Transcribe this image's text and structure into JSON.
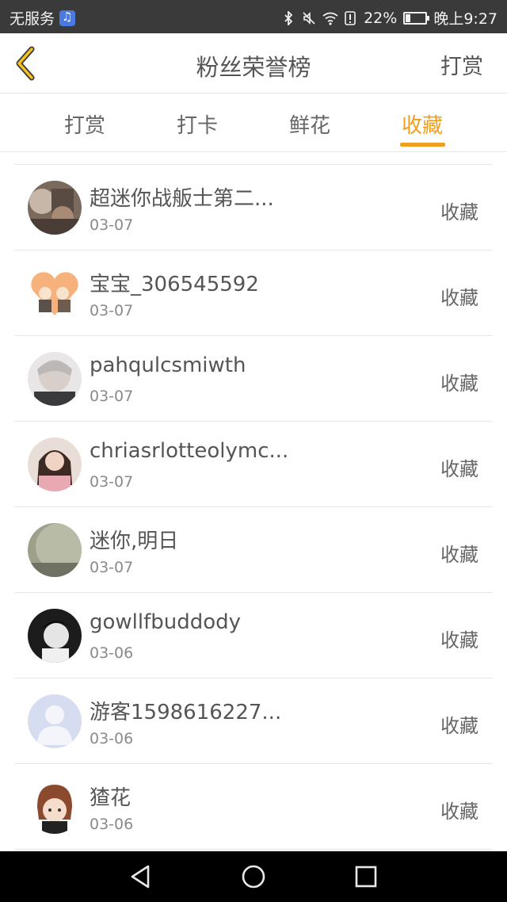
{
  "status_bar": {
    "carrier": "无服务",
    "battery_level": "22%",
    "battery_fraction": 0.22,
    "time": "晚上9:27",
    "icons": [
      "music-app-icon",
      "bluetooth-icon",
      "mute-icon",
      "wifi-icon",
      "alert-icon",
      "battery-icon"
    ]
  },
  "app_bar": {
    "title": "粉丝荣誉榜",
    "right_action": "打赏",
    "back_icon": "chevron-left-icon",
    "accent_color": "#f0a01e"
  },
  "tabs": [
    {
      "label": "打赏",
      "active": false
    },
    {
      "label": "打卡",
      "active": false
    },
    {
      "label": "鲜花",
      "active": false
    },
    {
      "label": "收藏",
      "active": true
    }
  ],
  "items": [
    {
      "name": "超迷你战舨士第二...",
      "date": "03-07",
      "type": "收藏",
      "avatar": "photo-avatar"
    },
    {
      "name": "宝宝_306545592",
      "date": "03-07",
      "type": "收藏",
      "avatar": "cartoon-avatar"
    },
    {
      "name": "pahqulcsmiwth",
      "date": "03-07",
      "type": "收藏",
      "avatar": "photo-avatar"
    },
    {
      "name": "chriasrlotteolymc...",
      "date": "03-07",
      "type": "收藏",
      "avatar": "photo-avatar"
    },
    {
      "name": "迷你,明日",
      "date": "03-07",
      "type": "收藏",
      "avatar": "photo-avatar"
    },
    {
      "name": "gowllfbuddody",
      "date": "03-06",
      "type": "收藏",
      "avatar": "photo-avatar"
    },
    {
      "name": "游客1598616227...",
      "date": "03-06",
      "type": "收藏",
      "avatar": "default-user-avatar"
    },
    {
      "name": "猹花",
      "date": "03-06",
      "type": "收藏",
      "avatar": "cartoon-avatar"
    }
  ],
  "nav_bar": {
    "icons": [
      "back-triangle-icon",
      "home-circle-icon",
      "recents-square-icon"
    ]
  }
}
